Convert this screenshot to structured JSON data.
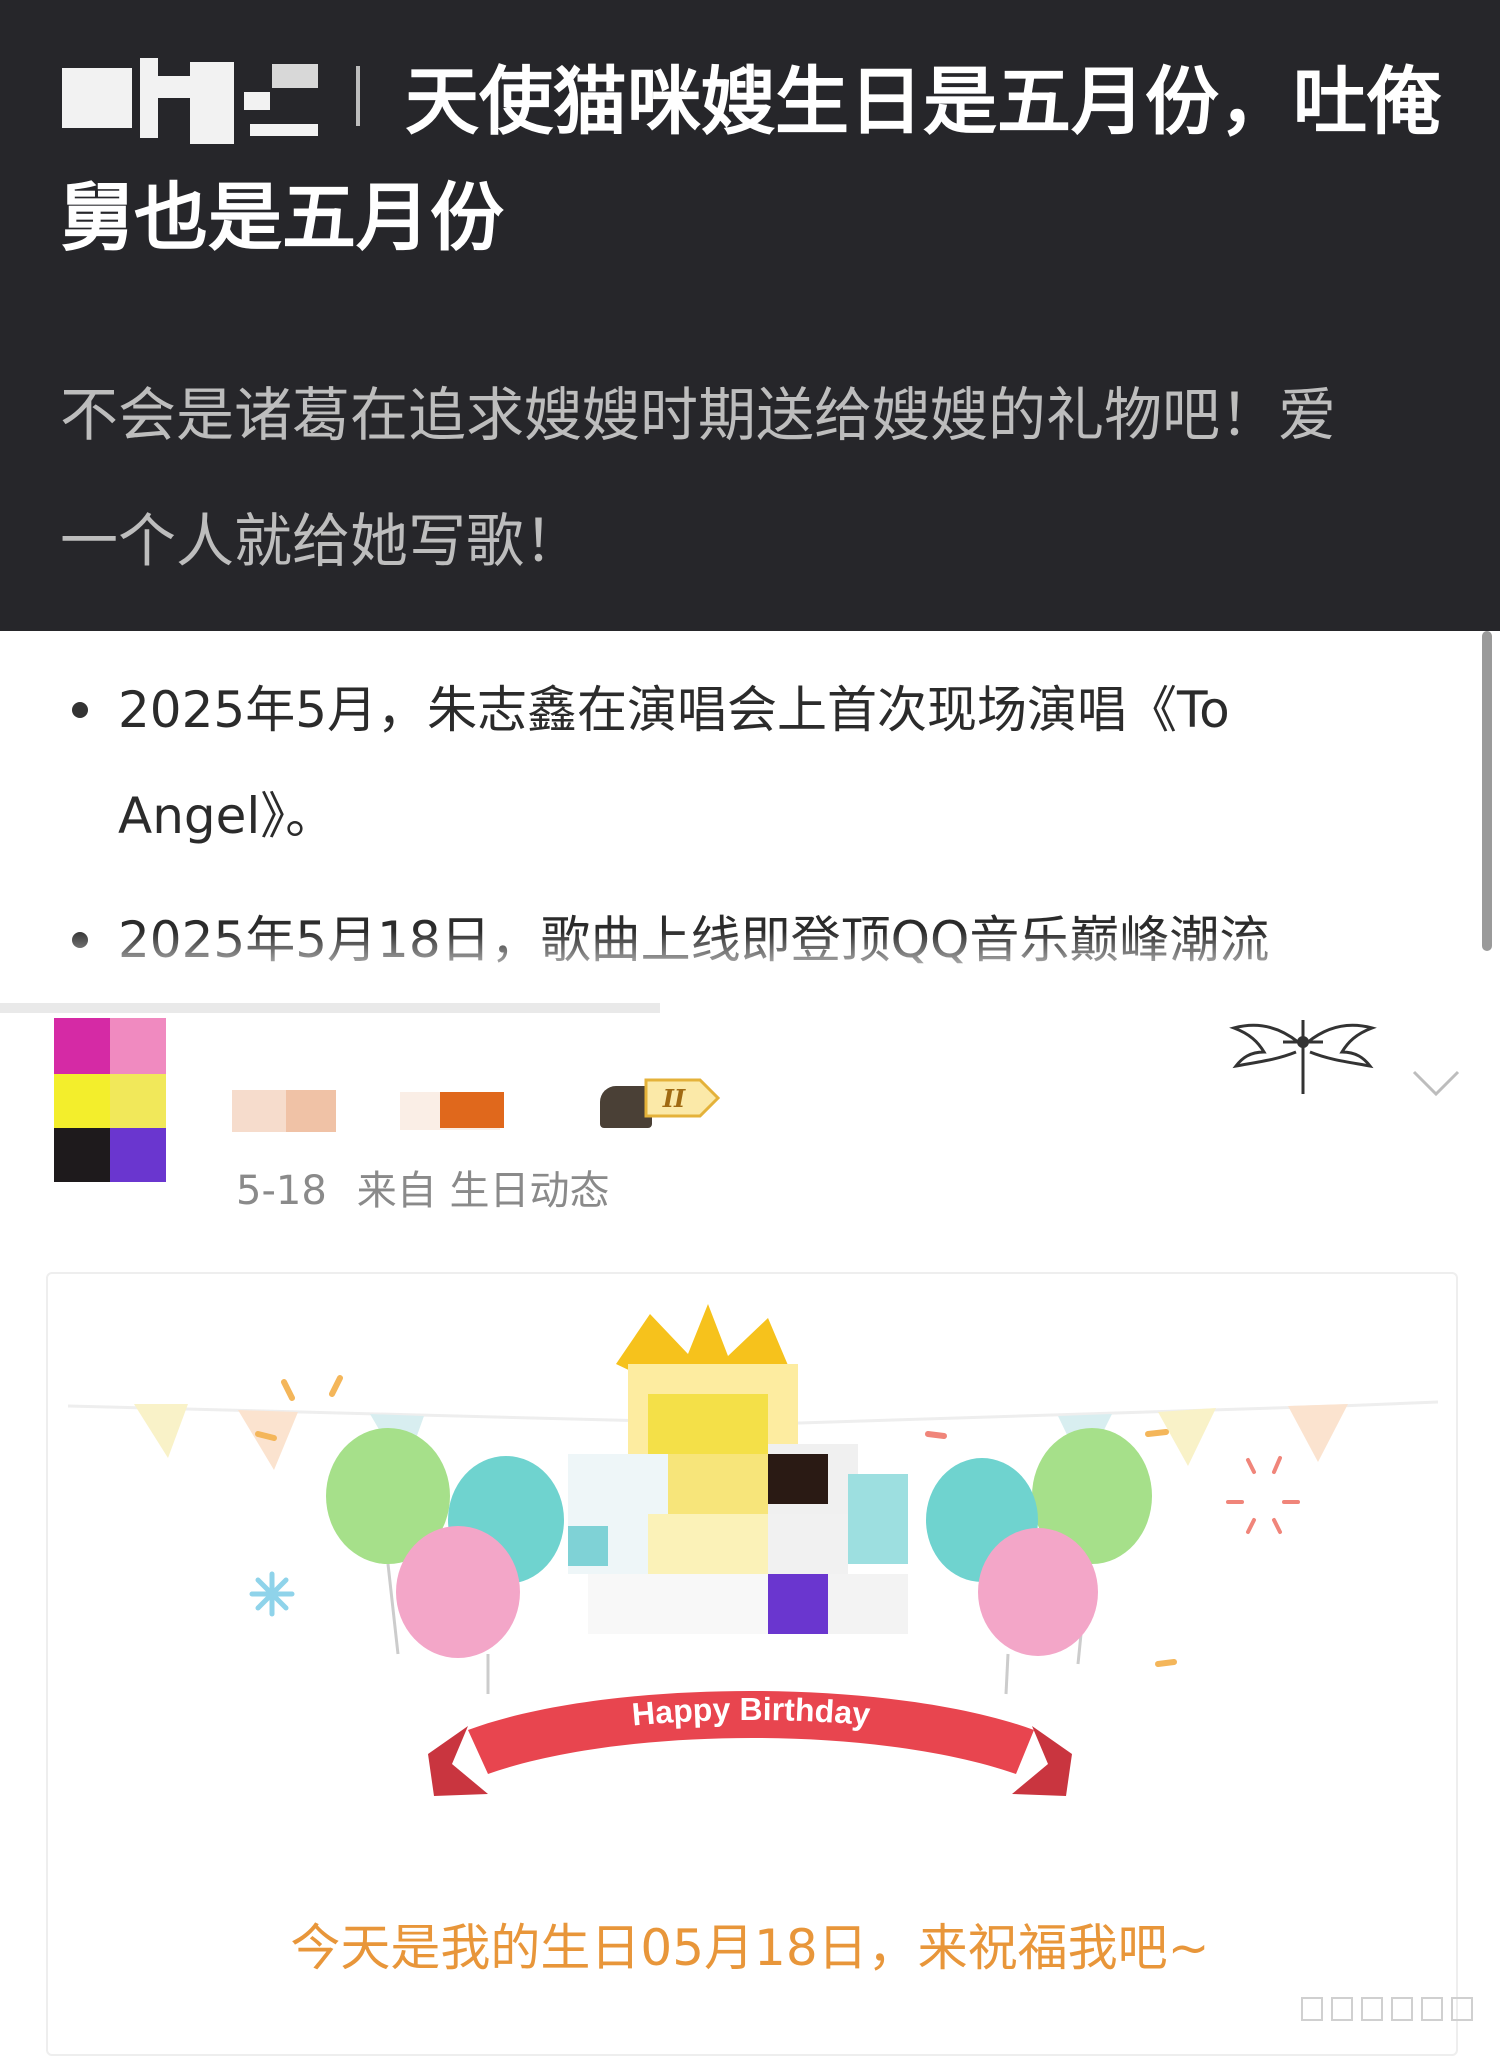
{
  "post": {
    "title": "天使猫咪嫂生日是五月份，吐俺舅也是五月份",
    "subtitle": "不会是诸葛在追求嫂嫂时期送给嫂嫂的礼物吧！爱一个人就给她写歌！"
  },
  "bullets": [
    "2025年5月，朱志鑫在演唱会上首次现场演唱《To Angel》。",
    "2025年5月18日，歌曲上线即登顶QQ音乐巅峰潮流"
  ],
  "weibo": {
    "vip_badge": "II",
    "date": "5-18",
    "source": "来自 生日动态"
  },
  "birthday": {
    "banner": "Happy Birthday",
    "message": "今天是我的生日05月18日，来祝福我吧~"
  },
  "colors": {
    "header_bg": "#26262a",
    "accent_orange": "#e8963a",
    "ribbon_red": "#e8454f"
  }
}
